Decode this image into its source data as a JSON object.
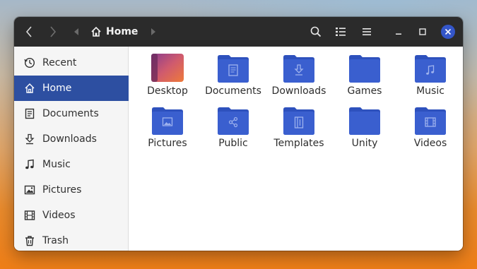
{
  "header": {
    "location": "Home"
  },
  "sidebar": {
    "items": [
      {
        "label": "Recent",
        "icon": "clock-icon"
      },
      {
        "label": "Home",
        "icon": "home-icon",
        "active": true
      },
      {
        "label": "Documents",
        "icon": "document-icon"
      },
      {
        "label": "Downloads",
        "icon": "download-icon"
      },
      {
        "label": "Music",
        "icon": "music-note-icon"
      },
      {
        "label": "Pictures",
        "icon": "picture-icon"
      },
      {
        "label": "Videos",
        "icon": "film-icon"
      },
      {
        "label": "Trash",
        "icon": "trash-icon"
      }
    ]
  },
  "files": [
    {
      "label": "Desktop",
      "icon": "desktop-folder-icon"
    },
    {
      "label": "Documents",
      "icon": "documents-folder-icon"
    },
    {
      "label": "Downloads",
      "icon": "downloads-folder-icon"
    },
    {
      "label": "Games",
      "icon": "folder-icon"
    },
    {
      "label": "Music",
      "icon": "music-folder-icon"
    },
    {
      "label": "Pictures",
      "icon": "pictures-folder-icon"
    },
    {
      "label": "Public",
      "icon": "public-folder-icon"
    },
    {
      "label": "Templates",
      "icon": "templates-folder-icon"
    },
    {
      "label": "Unity",
      "icon": "folder-icon"
    },
    {
      "label": "Videos",
      "icon": "videos-folder-icon"
    }
  ],
  "colors": {
    "accent": "#2d4fa1",
    "folder": "#2f56c4",
    "headerbar": "#2b2b2b",
    "close_button": "#3456c9"
  }
}
